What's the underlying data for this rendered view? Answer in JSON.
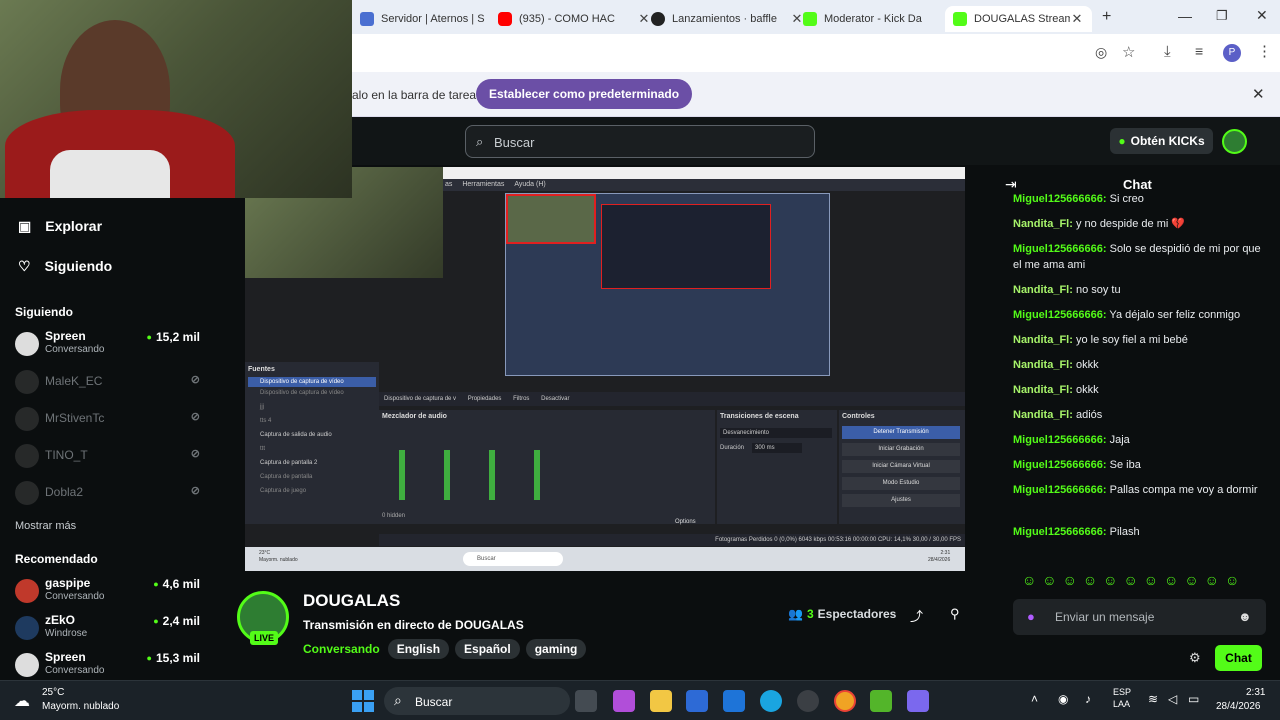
{
  "browser": {
    "tabs": [
      {
        "title": "Servidor | Aternos | S",
        "color": "#4a6fd1"
      },
      {
        "title": "(935) - COMO HAC",
        "color": "#ff0000"
      },
      {
        "title": "Lanzamientos · baffle",
        "color": "#222222"
      },
      {
        "title": "Moderator - Kick Da",
        "color": "#53fc18"
      },
      {
        "title": "DOUGALAS Stream",
        "color": "#53fc18"
      }
    ],
    "new_tab": "+",
    "avatar_letter": "P",
    "infobar": {
      "message": "alo en la barra de tareas",
      "button": "Establecer como predeterminado",
      "close": "✕"
    }
  },
  "kick": {
    "search_placeholder": "Buscar",
    "get_kicks": "Obtén KICKs",
    "nav": {
      "explore": "Explorar",
      "following": "Siguiendo"
    },
    "following_header": "Siguiendo",
    "following": [
      {
        "name": "Spreen",
        "category": "Conversando",
        "viewers": "15,2 mil",
        "online": true
      },
      {
        "name": "MaleK_EC",
        "online": false
      },
      {
        "name": "MrStivenTc",
        "online": false
      },
      {
        "name": "TINO_T",
        "online": false
      },
      {
        "name": "Dobla2",
        "online": false
      }
    ],
    "show_more": "Mostrar más",
    "recommended_header": "Recomendado",
    "recommended": [
      {
        "name": "gaspipe",
        "category": "Conversando",
        "viewers": "4,6 mil"
      },
      {
        "name": "zEkO",
        "category": "Windrose",
        "viewers": "2,4 mil"
      },
      {
        "name": "Spreen",
        "category": "Conversando",
        "viewers": "15,3 mil"
      }
    ],
    "stream": {
      "channel": "DOUGALAS",
      "title": "Transmisión en directo de DOUGALAS",
      "category": "Conversando",
      "tags": [
        "English",
        "Español",
        "gaming"
      ],
      "live": "LIVE",
      "viewer_count": "3",
      "viewer_label": "Espectadores"
    },
    "chat": {
      "title": "Chat",
      "messages": [
        {
          "user": "Miguel125666666:",
          "text": "Si creo"
        },
        {
          "user": "Nandita_Fl:",
          "text": "y no despide de mi 💔"
        },
        {
          "user": "Miguel125666666:",
          "text": "Solo se despidió de mi por que el me ama ami"
        },
        {
          "user": "Nandita_Fl:",
          "text": "no soy tu"
        },
        {
          "user": "Miguel125666666:",
          "text": "Ya déjalo ser feliz conmigo"
        },
        {
          "user": "Nandita_Fl:",
          "text": "yo le soy fiel a mi bebé"
        },
        {
          "user": "Nandita_Fl:",
          "text": "okkk"
        },
        {
          "user": "Nandita_Fl:",
          "text": "okkk"
        },
        {
          "user": "Nandita_Fl:",
          "text": "adiós"
        },
        {
          "user": "Miguel125666666:",
          "text": "Jaja"
        },
        {
          "user": "Miguel125666666:",
          "text": "Se iba"
        },
        {
          "user": "Miguel125666666:",
          "text": "Pallas compa me voy a dormir"
        },
        {
          "user": "Miguel125666666:",
          "text": "Pilash"
        }
      ],
      "input_placeholder": "Enviar un mensaje",
      "send": "Chat"
    }
  },
  "obs": {
    "menu": [
      "as",
      "Herramientas",
      "Ayuda (H)"
    ],
    "sources_title": "Fuentes",
    "sources": [
      "Dispositivo de captura de vídeo",
      "Dispositivo de captura de vídeo",
      "jjj",
      "tts 4",
      "Captura de salida de audio",
      "ttt",
      "Captura de pantalla 2",
      "Captura de pantalla",
      "Captura de juego"
    ],
    "source_bar": [
      "Dispositivo de captura de v",
      "Propiedades",
      "Filtros",
      "Desactivar"
    ],
    "mixer_title": "Mezclador de audio",
    "transitions_title": "Transiciones de escena",
    "transition": "Desvanecimiento",
    "duration_label": "Duración",
    "duration": "300 ms",
    "controls_title": "Controles",
    "controls": [
      "Detener Transmisión",
      "Iniciar Grabación",
      "Iniciar Cámara Virtual",
      "Modo Estudio",
      "Ajustes"
    ],
    "hidden": "0 hidden",
    "options": "Options",
    "status": "Fotogramas Perdidos 0 (0,0%)   6043 kbps   00:53:16   00:00:00   CPU: 14,1%   30,00 / 30,00 FPS",
    "inner_weather": "23°C\nMayorm. nublado",
    "inner_search": "Buscar",
    "inner_time": "2:31\n28/4/2026"
  },
  "taskbar": {
    "weather_temp": "25°C",
    "weather_desc": "Mayorm. nublado",
    "search": "Buscar",
    "lang": "ESP\nLAA",
    "time": "2:31",
    "date": "28/4/2026"
  }
}
